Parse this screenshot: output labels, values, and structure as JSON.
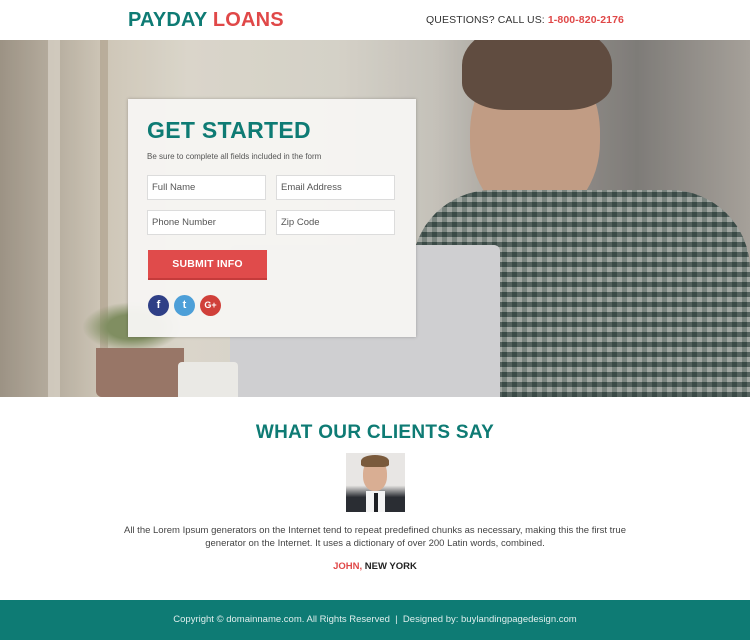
{
  "header": {
    "logo_part1": "PAYDAY",
    "logo_part2": "LOANS",
    "contact_label": "QUESTIONS? CALL US:",
    "phone": "1-800-820-2176"
  },
  "form": {
    "title": "GET STARTED",
    "subtitle": "Be sure to complete all fields included in the form",
    "fields": [
      {
        "placeholder": "Full Name",
        "value": ""
      },
      {
        "placeholder": "Email Address",
        "value": ""
      },
      {
        "placeholder": "Phone Number",
        "value": ""
      },
      {
        "placeholder": "Zip Code",
        "value": ""
      }
    ],
    "submit_label": "SUBMIT INFO",
    "social": [
      {
        "icon": "facebook-icon",
        "glyph": "f"
      },
      {
        "icon": "twitter-icon",
        "glyph": "t"
      },
      {
        "icon": "google-plus-icon",
        "glyph": "G+"
      }
    ]
  },
  "testimonials": {
    "title": "WHAT OUR CLIENTS SAY",
    "quote": "All the Lorem Ipsum generators on the Internet tend to repeat predefined chunks as necessary, making this the first true generator on the Internet. It uses a dictionary of over 200 Latin words, combined.",
    "author_name": "JOHN,",
    "author_location": " NEW YORK"
  },
  "footer": {
    "text": "Copyright © domainname.com. All Rights Reserved  |  Designed by: buylandingpagedesign.com"
  },
  "colors": {
    "brand_teal": "#0e7b74",
    "accent_red": "#e04848"
  }
}
